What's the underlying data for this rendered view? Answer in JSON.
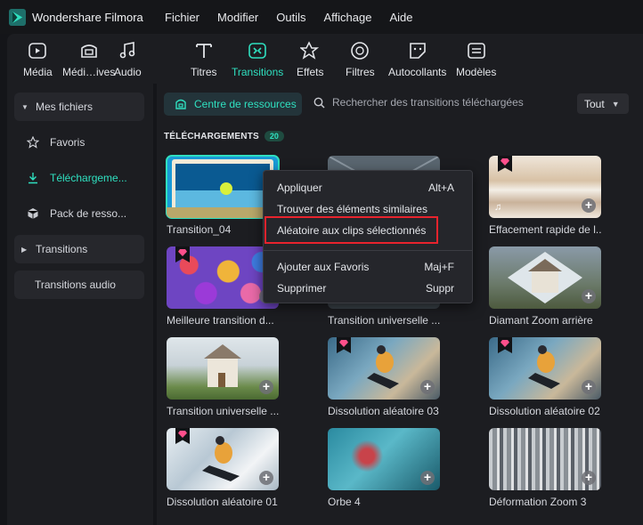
{
  "app": {
    "title": "Wondershare Filmora",
    "accent": "#2fe0c0"
  },
  "menubar": [
    "Fichier",
    "Modifier",
    "Outils",
    "Affichage",
    "Aide"
  ],
  "toolbar": {
    "tabs": [
      {
        "label": "Média",
        "icon": "media-icon"
      },
      {
        "label": "Médi…ives",
        "icon": "stock-media-icon"
      },
      {
        "label": "Audio",
        "icon": "audio-icon"
      },
      {
        "label": "Titres",
        "icon": "titles-icon"
      },
      {
        "label": "Transitions",
        "icon": "transitions-icon",
        "active": true
      },
      {
        "label": "Effets",
        "icon": "effects-icon"
      },
      {
        "label": "Filtres",
        "icon": "filters-icon"
      },
      {
        "label": "Autocollants",
        "icon": "stickers-icon"
      },
      {
        "label": "Modèles",
        "icon": "templates-icon"
      }
    ]
  },
  "sidebar": {
    "items": [
      {
        "label": "Mes fichiers",
        "type": "group-expanded"
      },
      {
        "label": "Favoris",
        "icon": "star-icon"
      },
      {
        "label": "Téléchargeme...",
        "icon": "download-icon",
        "active": true
      },
      {
        "label": "Pack de resso...",
        "icon": "package-icon"
      },
      {
        "label": "Transitions",
        "type": "group-collapsed"
      },
      {
        "label": "Transitions audio",
        "type": "group-plain"
      }
    ]
  },
  "main": {
    "resource_center": "Centre de ressources",
    "search_placeholder": "Rechercher des transitions téléchargées",
    "filter_value": "Tout",
    "section_title": "TÉLÉCHARGEMENTS",
    "section_count": "20",
    "items": [
      {
        "name": "Transition_04",
        "premium": false,
        "selected": true,
        "thumb": "tennis"
      },
      {
        "name": "",
        "premium": false,
        "thumb": "envelope"
      },
      {
        "name": "Effacement rapide de l...",
        "premium": true,
        "thumb": "blur-light"
      },
      {
        "name": "Meilleure transition d...",
        "premium": true,
        "thumb": "eggs"
      },
      {
        "name": "Transition universelle ...",
        "premium": false,
        "thumb": "hidden"
      },
      {
        "name": "Diamant Zoom arrière",
        "premium": false,
        "thumb": "diamond-house"
      },
      {
        "name": "Transition universelle ...",
        "premium": false,
        "thumb": "house"
      },
      {
        "name": "Dissolution aléatoire 03",
        "premium": true,
        "thumb": "snowboard"
      },
      {
        "name": "Dissolution aléatoire 02",
        "premium": true,
        "thumb": "snowboard"
      },
      {
        "name": "Dissolution aléatoire 01",
        "premium": true,
        "thumb": "snowboard-blur"
      },
      {
        "name": "Orbe 4",
        "premium": false,
        "thumb": "orb"
      },
      {
        "name": "Déformation Zoom 3",
        "premium": false,
        "thumb": "city-zoom"
      }
    ]
  },
  "context_menu": {
    "items": [
      {
        "label": "Appliquer",
        "shortcut": "Alt+A"
      },
      {
        "label": "Trouver des éléments similaires",
        "shortcut": ""
      },
      {
        "label": "Aléatoire aux clips sélectionnés",
        "shortcut": "",
        "highlighted": true
      },
      {
        "label": "Ajouter aux Favoris",
        "shortcut": "Maj+F"
      },
      {
        "label": "Supprimer",
        "shortcut": "Suppr"
      }
    ]
  }
}
